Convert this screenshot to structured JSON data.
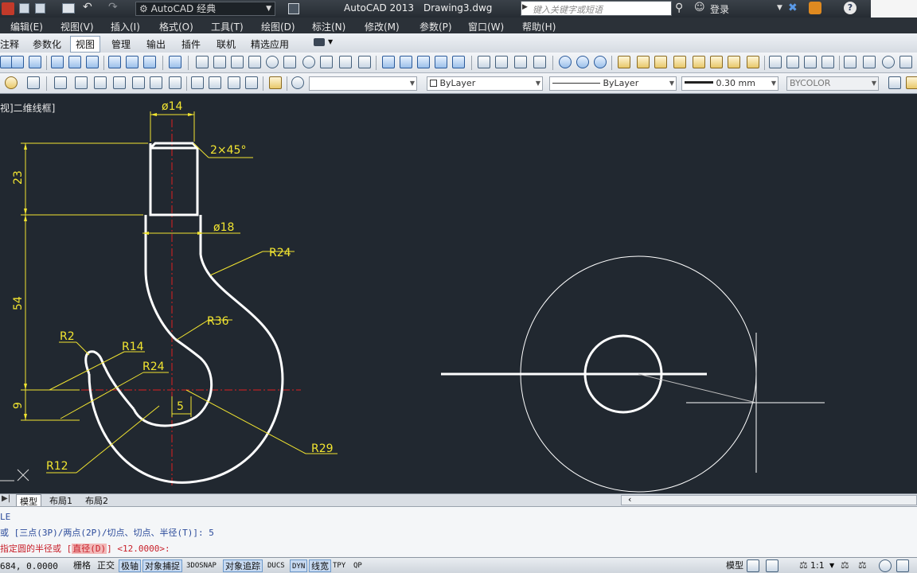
{
  "titlebar": {
    "workspace": "AutoCAD 经典",
    "app_title": "AutoCAD 2013",
    "file_name": "Drawing3.dwg",
    "search_placeholder": "键入关键字或短语",
    "login_label": "登录"
  },
  "menubar": {
    "items": [
      "编辑(E)",
      "视图(V)",
      "插入(I)",
      "格式(O)",
      "工具(T)",
      "绘图(D)",
      "标注(N)",
      "修改(M)",
      "参数(P)",
      "窗口(W)",
      "帮助(H)"
    ]
  },
  "ribbon_tabs": {
    "items": [
      "注释",
      "参数化",
      "视图",
      "管理",
      "输出",
      "插件",
      "联机",
      "精选应用"
    ],
    "active": "视图"
  },
  "properties": {
    "color": "ByLayer",
    "linetype": "ByLayer",
    "lineweight": "0.30 mm",
    "plotstyle": "BYCOLOR"
  },
  "viewport": {
    "label": "视]二维线框]"
  },
  "drawing": {
    "dims": {
      "d14": "ø14",
      "chamfer": "2×45°",
      "d18": "ø18",
      "r24_top": "R24",
      "r36": "R36",
      "r2": "R2",
      "r14": "R14",
      "r24_left": "R24",
      "r12": "R12",
      "r29": "R29",
      "len23": "23",
      "len54": "54",
      "len9": "9",
      "off5": "5"
    },
    "colors": {
      "background": "#212830",
      "geometry": "#ffffff",
      "dimension": "#f2e530",
      "centerline": "#e02020"
    }
  },
  "layout_tabs": {
    "items": [
      "模型",
      "布局1",
      "布局2"
    ],
    "active": "模型"
  },
  "command": {
    "line1": "LE",
    "line2": "或 [三点(3P)/两点(2P)/切点、切点、半径(T)]: 5",
    "line3_prefix": "指定圆的半径或 [",
    "line3_highlight": "直径(D)",
    "line3_suffix": "] <12.0000>:"
  },
  "statusbar": {
    "coords": "684, 0.0000",
    "toggles": [
      "栅格",
      "正交",
      "极轴",
      "对象捕捉",
      "3DOSNAP",
      "对象追踪",
      "DUCS",
      "DYN",
      "线宽",
      "TPY",
      "QP"
    ],
    "model_label": "模型",
    "scale": "1:1"
  }
}
